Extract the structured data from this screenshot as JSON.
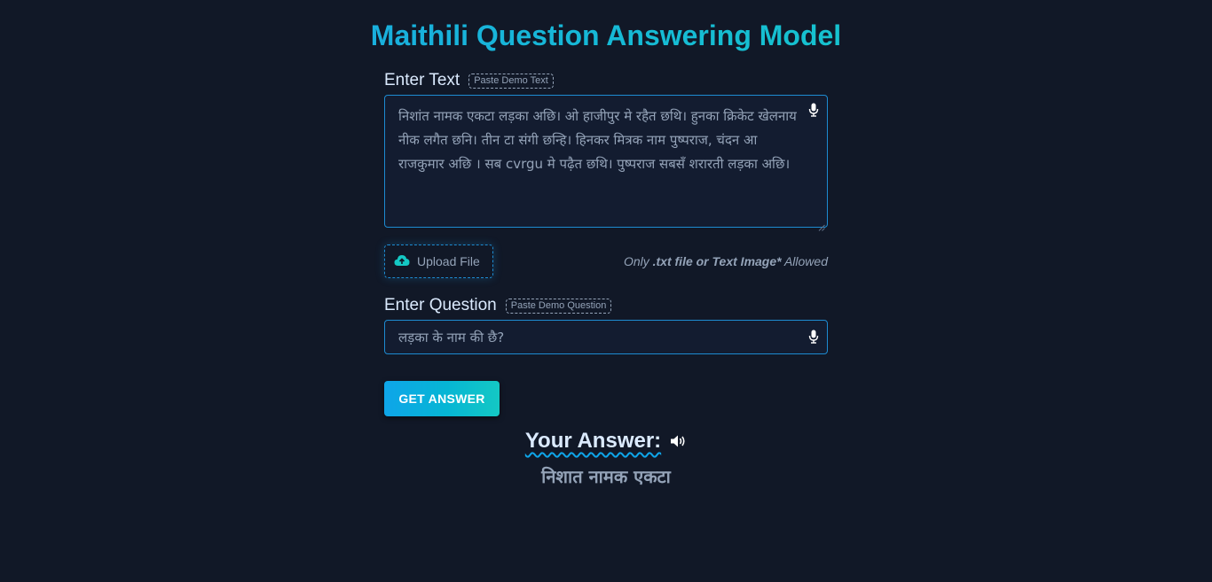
{
  "page": {
    "title": "Maithili Question Answering Model"
  },
  "text_section": {
    "label": "Enter Text",
    "demo_button": "Paste Demo Text",
    "value": "निशांत नामक एकटा लड़का अछि। ओ हाजीपुर मे रहैत छथि। हुनका क्रिकेट खेलनाय नीक लगैत छनि। तीन टा संगी छन्हि। हिनकर मित्रक नाम पुष्पराज, चंदन आ राजकुमार अछि । सब cvrgu मे पढ़ैत छथि। पुष्पराज सबसँ शरारती लड़का अछि।",
    "mic_icon": "microphone-icon"
  },
  "upload": {
    "label": "Upload File",
    "icon": "cloud-upload-icon",
    "note_prefix": "Only ",
    "note_bold": ".txt file or Text Image*",
    "note_suffix": " Allowed"
  },
  "question_section": {
    "label": "Enter Question",
    "demo_button": "Paste Demo Question",
    "value": "लड़का के नाम की छै?",
    "mic_icon": "microphone-icon"
  },
  "action": {
    "submit_label": "GET ANSWER"
  },
  "answer": {
    "heading": "Your Answer:",
    "speaker_icon": "speaker-icon",
    "value": "निशात नामक एकटा"
  },
  "colors": {
    "background": "#111827",
    "accent": "#1d8bd1",
    "title_gradient_start": "#1ea0e8",
    "title_gradient_end": "#16d0c3",
    "button_gradient_start": "#0ea5e9",
    "button_gradient_end": "#14c8c4"
  }
}
